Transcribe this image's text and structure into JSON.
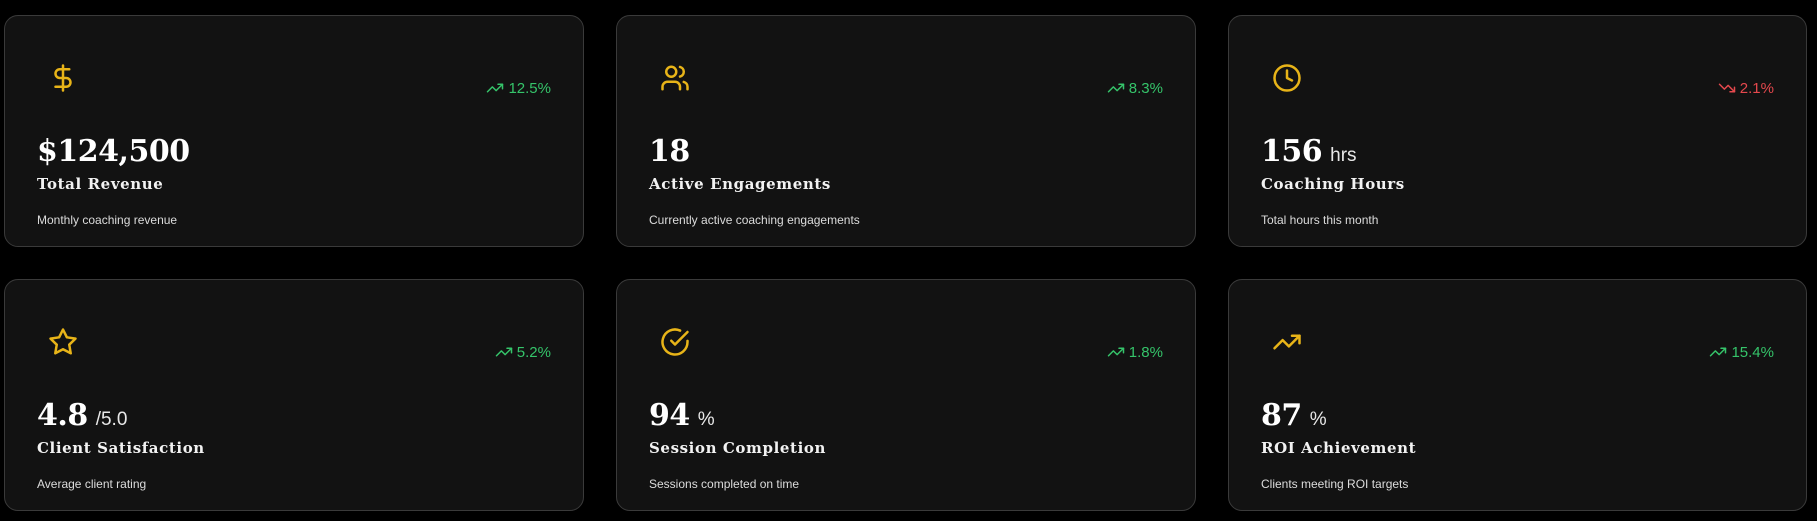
{
  "colors": {
    "accent": "#e8b418",
    "positive": "#35c46a",
    "negative": "#e5484d",
    "card_bg": "#121212",
    "border": "#3a3a3a"
  },
  "cards": [
    {
      "icon": "dollar-icon",
      "trend_dir": "up",
      "trend": "12.5%",
      "value": "$124,500",
      "unit": "",
      "label": "Total Revenue",
      "description": "Monthly coaching revenue"
    },
    {
      "icon": "users-icon",
      "trend_dir": "up",
      "trend": "8.3%",
      "value": "18",
      "unit": "",
      "label": "Active Engagements",
      "description": "Currently active coaching engagements"
    },
    {
      "icon": "clock-icon",
      "trend_dir": "down",
      "trend": "2.1%",
      "value": "156",
      "unit": "hrs",
      "label": "Coaching Hours",
      "description": "Total hours this month"
    },
    {
      "icon": "star-icon",
      "trend_dir": "up",
      "trend": "5.2%",
      "value": "4.8",
      "unit": "/5.0",
      "label": "Client Satisfaction",
      "description": "Average client rating"
    },
    {
      "icon": "check-circle-icon",
      "trend_dir": "up",
      "trend": "1.8%",
      "value": "94",
      "unit": "%",
      "label": "Session Completion",
      "description": "Sessions completed on time"
    },
    {
      "icon": "trending-up-icon",
      "trend_dir": "up",
      "trend": "15.4%",
      "value": "87",
      "unit": "%",
      "label": "ROI Achievement",
      "description": "Clients meeting ROI targets"
    }
  ]
}
